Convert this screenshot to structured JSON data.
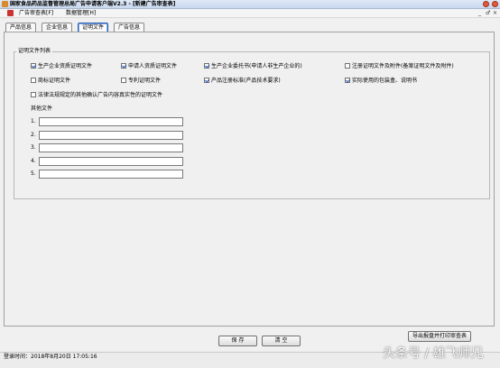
{
  "window": {
    "title": "国家食品药品监督管理总局广告申请客户端V2.3 - [新建广告审查表]"
  },
  "menubar": {
    "items": [
      "广告审查表[F]",
      "数据管理[H]"
    ],
    "mdi_controls": [
      "_",
      "♂",
      "×"
    ]
  },
  "tabs": [
    {
      "label": "产品信息",
      "active": false
    },
    {
      "label": "企业信息",
      "active": false
    },
    {
      "label": "证明文件",
      "active": true
    },
    {
      "label": "广告信息",
      "active": false
    }
  ],
  "group": {
    "title": "证明文件列表"
  },
  "checkboxes": [
    {
      "label": "生产企业资质证明文件",
      "checked": true
    },
    {
      "label": "申请人资质证明文件",
      "checked": true
    },
    {
      "label": "生产企业委托书(申请人非生产企业的)",
      "checked": true
    },
    {
      "label": "注册证明文件及附件(备案证明文件及附件)",
      "checked": false
    },
    {
      "label": "商标证明文件",
      "checked": false
    },
    {
      "label": "专利证明文件",
      "checked": false
    },
    {
      "label": "产品注册标准(产品技术要求)",
      "checked": true
    },
    {
      "label": "实际使用的包装盒、说明书",
      "checked": true
    },
    {
      "label": "法律法规规定的其他确认广告内容真实性的证明文件",
      "checked": false
    }
  ],
  "other_files": {
    "label": "其他文件",
    "rows": [
      {
        "num": "1.",
        "value": ""
      },
      {
        "num": "2.",
        "value": ""
      },
      {
        "num": "3.",
        "value": ""
      },
      {
        "num": "4.",
        "value": ""
      },
      {
        "num": "5.",
        "value": ""
      }
    ]
  },
  "buttons": {
    "save": "保 存",
    "clear": "清 空",
    "export": "导出报盘并打印审查表"
  },
  "status": {
    "login_time": "登录时间：2018年8月20日 17:05:16"
  },
  "watermark": "头条号 / 雄飞师兄",
  "colors": {
    "active_tab": "#2b5fb3",
    "check": "#1a4fb5",
    "window_button": "#e05a3a"
  }
}
